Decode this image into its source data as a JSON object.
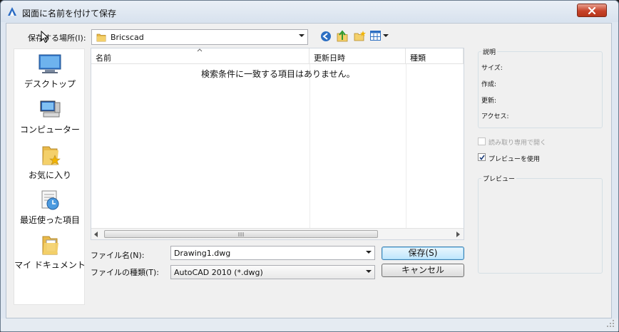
{
  "window": {
    "title": "図面に名前を付けて保存"
  },
  "location": {
    "label": "保存する場所(I):",
    "value": "Bricscad"
  },
  "places": [
    {
      "label": "デスクトップ",
      "icon": "desktop-icon"
    },
    {
      "label": "コンピューター",
      "icon": "computer-icon"
    },
    {
      "label": "お気に入り",
      "icon": "favorites-icon"
    },
    {
      "label": "最近使った項目",
      "icon": "recent-items-icon"
    },
    {
      "label": "マイ ドキュメント",
      "icon": "my-documents-icon"
    }
  ],
  "filelist": {
    "columns": [
      "名前",
      "更新日時",
      "種類"
    ],
    "empty_message": "検索条件に一致する項目はありません。"
  },
  "fields": {
    "filename_label": "ファイル名(N):",
    "filename_value": "Drawing1.dwg",
    "filetype_label": "ファイルの種類(T):",
    "filetype_value": "AutoCAD 2010 (*.dwg)"
  },
  "buttons": {
    "save": "保存(S)",
    "cancel": "キャンセル"
  },
  "description": {
    "title": "説明",
    "size": "サイズ:",
    "created": "作成:",
    "modified": "更新:",
    "access": "アクセス:"
  },
  "options": {
    "readonly": "読み取り専用で開く",
    "readonly_checked": false,
    "readonly_enabled": false,
    "preview": "プレビューを使用",
    "preview_checked": true
  },
  "preview": {
    "title": "プレビュー"
  },
  "colors": {
    "title_bg": "#dfe7f1",
    "close_red": "#c7432a",
    "default_button": "#bee6fd",
    "folder_yellow": "#f4d06a"
  }
}
